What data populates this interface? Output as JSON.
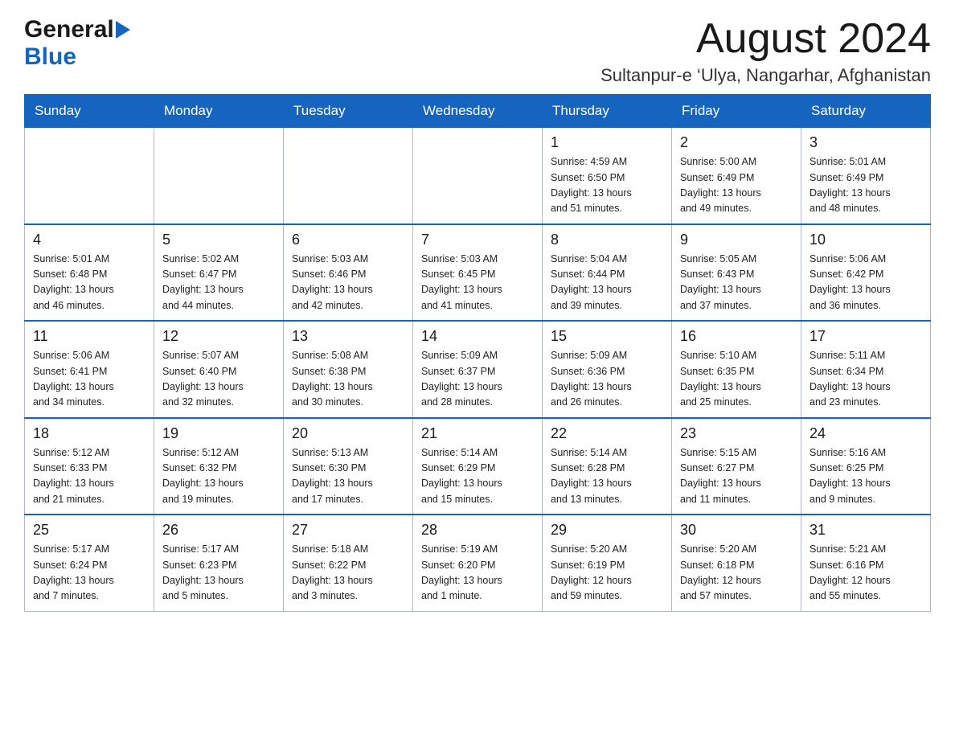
{
  "header": {
    "logo_general": "General",
    "logo_blue": "Blue",
    "month_title": "August 2024",
    "location": "Sultanpur-e ‘Ulya, Nangarhar, Afghanistan"
  },
  "days_of_week": [
    "Sunday",
    "Monday",
    "Tuesday",
    "Wednesday",
    "Thursday",
    "Friday",
    "Saturday"
  ],
  "weeks": [
    [
      {
        "day": "",
        "info": ""
      },
      {
        "day": "",
        "info": ""
      },
      {
        "day": "",
        "info": ""
      },
      {
        "day": "",
        "info": ""
      },
      {
        "day": "1",
        "info": "Sunrise: 4:59 AM\nSunset: 6:50 PM\nDaylight: 13 hours\nand 51 minutes."
      },
      {
        "day": "2",
        "info": "Sunrise: 5:00 AM\nSunset: 6:49 PM\nDaylight: 13 hours\nand 49 minutes."
      },
      {
        "day": "3",
        "info": "Sunrise: 5:01 AM\nSunset: 6:49 PM\nDaylight: 13 hours\nand 48 minutes."
      }
    ],
    [
      {
        "day": "4",
        "info": "Sunrise: 5:01 AM\nSunset: 6:48 PM\nDaylight: 13 hours\nand 46 minutes."
      },
      {
        "day": "5",
        "info": "Sunrise: 5:02 AM\nSunset: 6:47 PM\nDaylight: 13 hours\nand 44 minutes."
      },
      {
        "day": "6",
        "info": "Sunrise: 5:03 AM\nSunset: 6:46 PM\nDaylight: 13 hours\nand 42 minutes."
      },
      {
        "day": "7",
        "info": "Sunrise: 5:03 AM\nSunset: 6:45 PM\nDaylight: 13 hours\nand 41 minutes."
      },
      {
        "day": "8",
        "info": "Sunrise: 5:04 AM\nSunset: 6:44 PM\nDaylight: 13 hours\nand 39 minutes."
      },
      {
        "day": "9",
        "info": "Sunrise: 5:05 AM\nSunset: 6:43 PM\nDaylight: 13 hours\nand 37 minutes."
      },
      {
        "day": "10",
        "info": "Sunrise: 5:06 AM\nSunset: 6:42 PM\nDaylight: 13 hours\nand 36 minutes."
      }
    ],
    [
      {
        "day": "11",
        "info": "Sunrise: 5:06 AM\nSunset: 6:41 PM\nDaylight: 13 hours\nand 34 minutes."
      },
      {
        "day": "12",
        "info": "Sunrise: 5:07 AM\nSunset: 6:40 PM\nDaylight: 13 hours\nand 32 minutes."
      },
      {
        "day": "13",
        "info": "Sunrise: 5:08 AM\nSunset: 6:38 PM\nDaylight: 13 hours\nand 30 minutes."
      },
      {
        "day": "14",
        "info": "Sunrise: 5:09 AM\nSunset: 6:37 PM\nDaylight: 13 hours\nand 28 minutes."
      },
      {
        "day": "15",
        "info": "Sunrise: 5:09 AM\nSunset: 6:36 PM\nDaylight: 13 hours\nand 26 minutes."
      },
      {
        "day": "16",
        "info": "Sunrise: 5:10 AM\nSunset: 6:35 PM\nDaylight: 13 hours\nand 25 minutes."
      },
      {
        "day": "17",
        "info": "Sunrise: 5:11 AM\nSunset: 6:34 PM\nDaylight: 13 hours\nand 23 minutes."
      }
    ],
    [
      {
        "day": "18",
        "info": "Sunrise: 5:12 AM\nSunset: 6:33 PM\nDaylight: 13 hours\nand 21 minutes."
      },
      {
        "day": "19",
        "info": "Sunrise: 5:12 AM\nSunset: 6:32 PM\nDaylight: 13 hours\nand 19 minutes."
      },
      {
        "day": "20",
        "info": "Sunrise: 5:13 AM\nSunset: 6:30 PM\nDaylight: 13 hours\nand 17 minutes."
      },
      {
        "day": "21",
        "info": "Sunrise: 5:14 AM\nSunset: 6:29 PM\nDaylight: 13 hours\nand 15 minutes."
      },
      {
        "day": "22",
        "info": "Sunrise: 5:14 AM\nSunset: 6:28 PM\nDaylight: 13 hours\nand 13 minutes."
      },
      {
        "day": "23",
        "info": "Sunrise: 5:15 AM\nSunset: 6:27 PM\nDaylight: 13 hours\nand 11 minutes."
      },
      {
        "day": "24",
        "info": "Sunrise: 5:16 AM\nSunset: 6:25 PM\nDaylight: 13 hours\nand 9 minutes."
      }
    ],
    [
      {
        "day": "25",
        "info": "Sunrise: 5:17 AM\nSunset: 6:24 PM\nDaylight: 13 hours\nand 7 minutes."
      },
      {
        "day": "26",
        "info": "Sunrise: 5:17 AM\nSunset: 6:23 PM\nDaylight: 13 hours\nand 5 minutes."
      },
      {
        "day": "27",
        "info": "Sunrise: 5:18 AM\nSunset: 6:22 PM\nDaylight: 13 hours\nand 3 minutes."
      },
      {
        "day": "28",
        "info": "Sunrise: 5:19 AM\nSunset: 6:20 PM\nDaylight: 13 hours\nand 1 minute."
      },
      {
        "day": "29",
        "info": "Sunrise: 5:20 AM\nSunset: 6:19 PM\nDaylight: 12 hours\nand 59 minutes."
      },
      {
        "day": "30",
        "info": "Sunrise: 5:20 AM\nSunset: 6:18 PM\nDaylight: 12 hours\nand 57 minutes."
      },
      {
        "day": "31",
        "info": "Sunrise: 5:21 AM\nSunset: 6:16 PM\nDaylight: 12 hours\nand 55 minutes."
      }
    ]
  ]
}
